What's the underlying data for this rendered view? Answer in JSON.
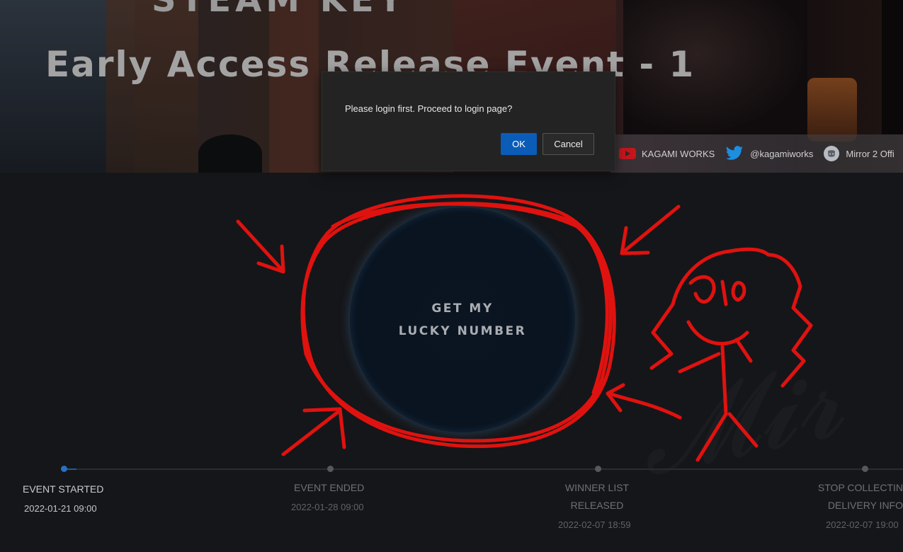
{
  "banner": {
    "title_top": "STEAM KEY",
    "title": "Early Access Release Event - 1",
    "social": [
      {
        "icon": "youtube-icon",
        "label": "KAGAMI WORKS"
      },
      {
        "icon": "twitter-icon",
        "label": "@kagamiworks"
      },
      {
        "icon": "discord-icon",
        "label": "Mirror 2 Offi"
      }
    ]
  },
  "dialog": {
    "message": "Please login first. Proceed to login page?",
    "ok_label": "OK",
    "cancel_label": "Cancel"
  },
  "main": {
    "button_line1": "GET MY",
    "button_line2": "LUCKY NUMBER"
  },
  "timeline": [
    {
      "line1": "EVENT STARTED",
      "line2": "",
      "date": "2022-01-21 09:00",
      "active": true
    },
    {
      "line1": "EVENT ENDED",
      "line2": "",
      "date": "2022-01-28 09:00",
      "active": false
    },
    {
      "line1": "WINNER LIST",
      "line2": "RELEASED",
      "date": "2022-02-07 18:59",
      "active": false
    },
    {
      "line1": "STOP COLLECTIN",
      "line2": "DELIVERY INFO",
      "date": "2022-02-07 19:00",
      "active": false
    }
  ],
  "colors": {
    "accent": "#0b5cb7",
    "annotation": "#e0120f",
    "background": "#151619"
  }
}
